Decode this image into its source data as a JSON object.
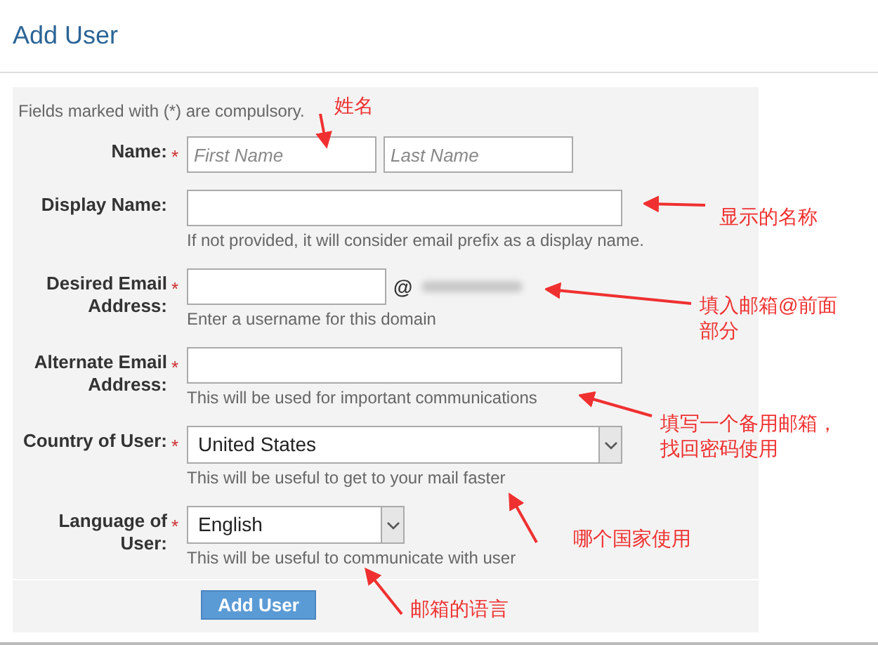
{
  "page_title": "Add User",
  "note": "Fields marked with (*) are compulsory.",
  "fields": [
    {
      "kind": "name-pair",
      "label": "Name:",
      "required_mark": "*",
      "placeholders": [
        "First Name",
        "Last Name"
      ]
    },
    {
      "kind": "text",
      "label": "Display Name:",
      "help": "If not provided, it will consider email prefix as a display name."
    },
    {
      "kind": "email",
      "label": "Desired Email Address:",
      "required_mark": "*",
      "at": "@",
      "help": "Enter a username for this domain"
    },
    {
      "kind": "text",
      "label": "Alternate Email Address:",
      "required_mark": "*",
      "help": "This will be used for important communications"
    },
    {
      "kind": "select",
      "label": "Country of User:",
      "required_mark": "*",
      "value": "United States",
      "help": "This will be useful to get to your mail faster"
    },
    {
      "kind": "select-small",
      "label": "Language of User:",
      "required_mark": "*",
      "value": "English",
      "help": "This will be useful to communicate with user"
    }
  ],
  "submit": "Add User",
  "annotations": [
    {
      "text": "姓名"
    },
    {
      "text": "显示的名称"
    },
    {
      "text": "填入邮箱@前面部分"
    },
    {
      "text": "填写一个备用邮箱，找回密码使用"
    },
    {
      "text": "哪个国家使用"
    },
    {
      "text": "邮箱的语言"
    }
  ]
}
